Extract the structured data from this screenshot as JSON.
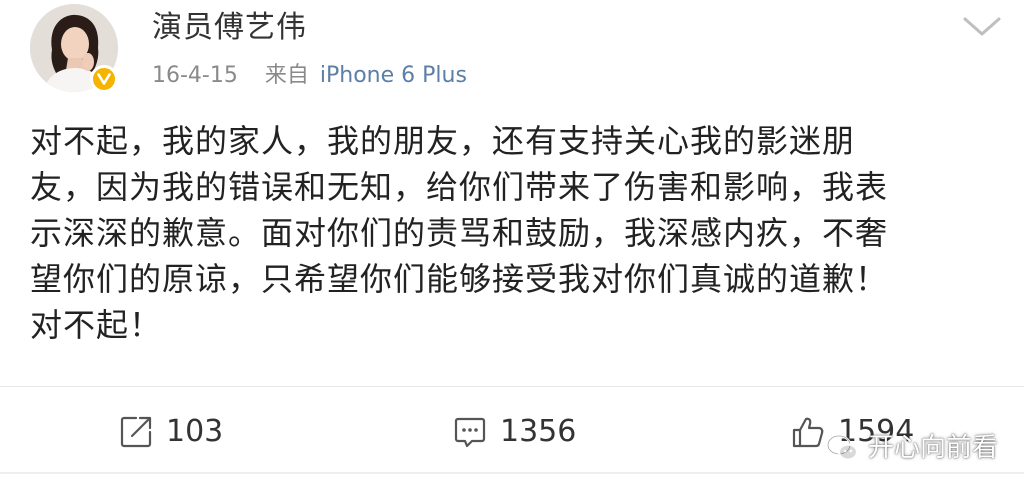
{
  "header": {
    "username": "演员傅艺伟",
    "date": "16-4-15",
    "source_prefix": "来自",
    "device": "iPhone 6 Plus"
  },
  "post": {
    "lines": [
      "对不起，我的家人，我的朋友，还有支持关心我的影迷朋",
      "友，因为我的错误和无知，给你们带来了伤害和影响，我表",
      "示深深的歉意。面对你们的责骂和鼓励，我深感内疚，不奢",
      "望你们的原谅，只希望你们能够接受我对你们真诚的道歉！",
      "对不起！"
    ]
  },
  "actions": {
    "repost_count": "103",
    "comment_count": "1356",
    "like_count": "1594"
  },
  "watermark": {
    "text": "开心向前看"
  },
  "icons": {
    "avatar": "avatar",
    "verified": "verified-badge-icon",
    "menu": "chevron-down-icon",
    "repost": "repost-icon",
    "comment": "comment-icon",
    "like": "thumbs-up-icon",
    "watermark": "wechat-icon"
  },
  "colors": {
    "text": "#222222",
    "meta": "#8a8a8a",
    "device_link": "#5b7fa7",
    "verified": "#f5b400"
  }
}
